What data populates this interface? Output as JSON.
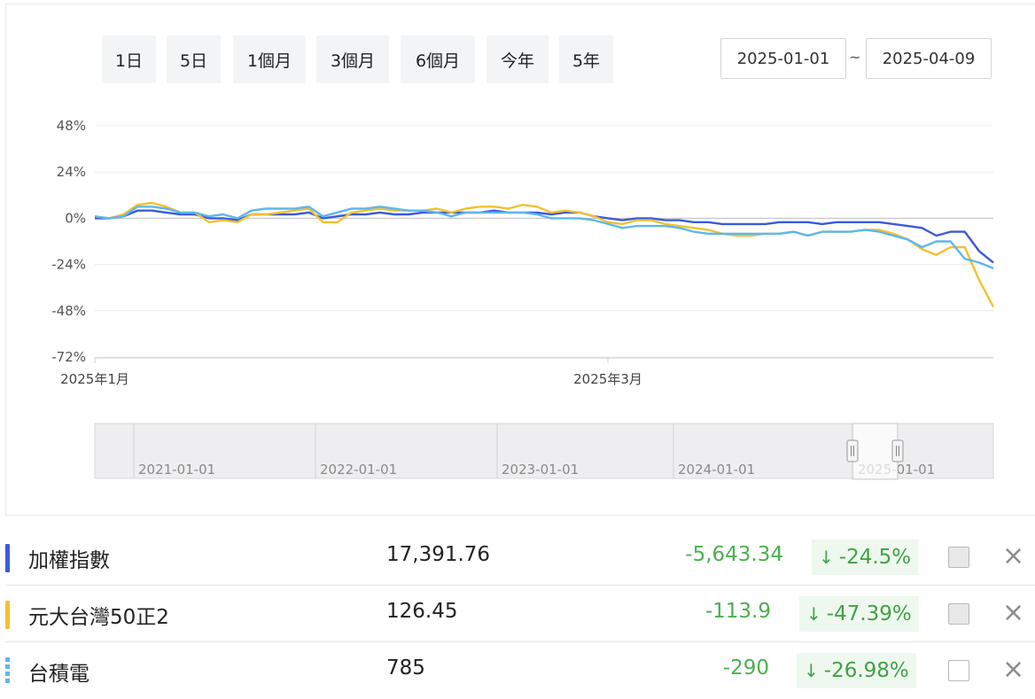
{
  "range_buttons": [
    "1日",
    "5日",
    "1個月",
    "3個月",
    "6個月",
    "今年",
    "5年"
  ],
  "date_range": {
    "start": "2025-01-01",
    "separator": "~",
    "end": "2025-04-09"
  },
  "chart_data": {
    "type": "line",
    "ylabel": "",
    "ylim": [
      -72,
      48
    ],
    "yticks": [
      "48%",
      "24%",
      "0%",
      "-24%",
      "-48%",
      "-72%"
    ],
    "x_tick_labels": [
      "2025年1月",
      "2025年3月"
    ],
    "grid": true,
    "series": [
      {
        "name": "加權指數",
        "color": "#3a5bd9",
        "values": [
          0,
          0,
          1,
          4,
          4,
          3,
          2,
          2,
          0,
          0,
          -1,
          2,
          2,
          2,
          2,
          3,
          0,
          1,
          2,
          2,
          3,
          2,
          2,
          3,
          3,
          3,
          3,
          3,
          4,
          3,
          3,
          3,
          2,
          3,
          3,
          1,
          0,
          -1,
          0,
          0,
          -1,
          -1,
          -2,
          -2,
          -3,
          -3,
          -3,
          -3,
          -2,
          -2,
          -2,
          -3,
          -2,
          -2,
          -2,
          -2,
          -3,
          -4,
          -5,
          -9,
          -7,
          -7,
          -17,
          -23
        ]
      },
      {
        "name": "元大台灣50正2",
        "color": "#f2c12e",
        "values": [
          1,
          0,
          2,
          7,
          8,
          6,
          3,
          3,
          -2,
          -1,
          -2,
          2,
          2,
          3,
          4,
          5,
          -2,
          -2,
          3,
          4,
          5,
          4,
          4,
          4,
          5,
          3,
          5,
          6,
          6,
          5,
          7,
          6,
          3,
          4,
          3,
          1,
          -2,
          -3,
          -1,
          -1,
          -3,
          -4,
          -5,
          -6,
          -8,
          -9,
          -9,
          -8,
          -8,
          -7,
          -9,
          -7,
          -7,
          -7,
          -6,
          -6,
          -8,
          -11,
          -16,
          -19,
          -15,
          -15,
          -32,
          -46
        ]
      },
      {
        "name": "台積電",
        "color": "#5db7ec",
        "values": [
          1,
          0,
          1,
          6,
          6,
          5,
          3,
          3,
          1,
          2,
          0,
          4,
          5,
          5,
          5,
          6,
          1,
          3,
          5,
          5,
          6,
          5,
          4,
          4,
          3,
          1,
          3,
          3,
          3,
          3,
          3,
          2,
          0,
          0,
          0,
          -1,
          -3,
          -5,
          -4,
          -4,
          -4,
          -5,
          -7,
          -8,
          -8,
          -8,
          -8,
          -8,
          -8,
          -7,
          -9,
          -7,
          -7,
          -7,
          -6,
          -7,
          -9,
          -11,
          -15,
          -12,
          -12,
          -21,
          -23,
          -26
        ]
      }
    ]
  },
  "navigator": {
    "labels": [
      "2021-01-01",
      "2022-01-01",
      "2023-01-01",
      "2024-01-01",
      "2025-01-01"
    ]
  },
  "rows": [
    {
      "name": "加權指數",
      "color": "#3a5bd9",
      "price": "17,391.76",
      "change": "-5,643.34",
      "pct": "-24.5%",
      "checked": true,
      "dashed": false
    },
    {
      "name": "元大台灣50正2",
      "color": "#f2c12e",
      "price": "126.45",
      "change": "-113.9",
      "pct": "-47.39%",
      "checked": true,
      "dashed": false
    },
    {
      "name": "台積電",
      "color": "#5db7ec",
      "price": "785",
      "change": "-290",
      "pct": "-26.98%",
      "checked": false,
      "dashed": true
    }
  ],
  "icons": {
    "down_arrow": "arrow-down-icon",
    "close": "close-icon"
  }
}
